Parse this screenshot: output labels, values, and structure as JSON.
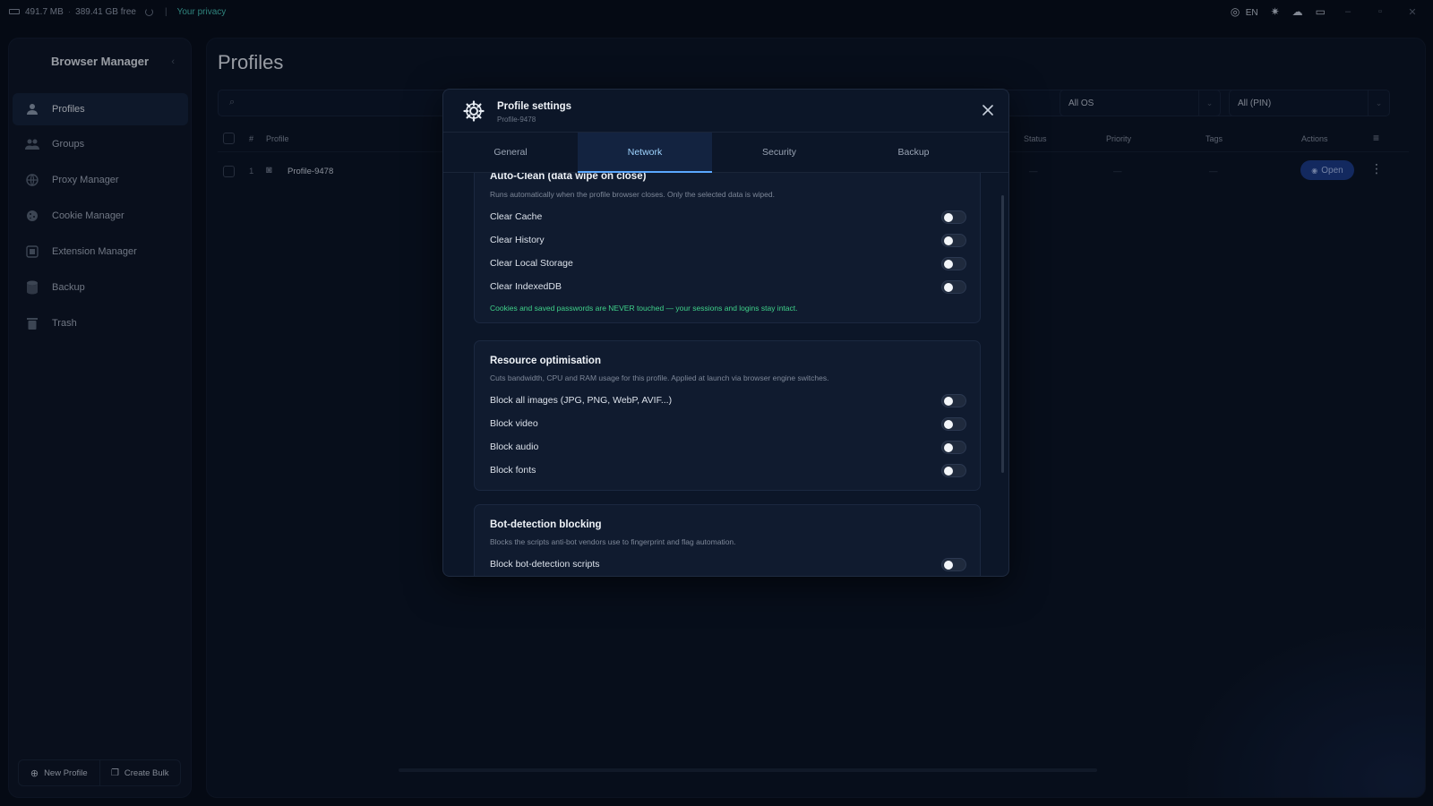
{
  "titlebar": {
    "memory": "491.7 MB",
    "disk": "389.41 GB free",
    "privacy_link": "Your privacy",
    "language": "EN"
  },
  "sidebar": {
    "title": "Browser Manager",
    "items": [
      {
        "label": "Profiles",
        "icon": "user-icon"
      },
      {
        "label": "Groups",
        "icon": "users-icon"
      },
      {
        "label": "Proxy Manager",
        "icon": "globe-icon"
      },
      {
        "label": "Cookie Manager",
        "icon": "cookie-icon"
      },
      {
        "label": "Extension Manager",
        "icon": "puzzle-icon"
      },
      {
        "label": "Backup",
        "icon": "database-icon"
      },
      {
        "label": "Trash",
        "icon": "trash-icon"
      }
    ],
    "new_profile": "New Profile",
    "create_bulk": "Create Bulk"
  },
  "main": {
    "title": "Profiles",
    "filters": {
      "os": "All OS",
      "pin": "All (PIN)"
    },
    "columns": {
      "num": "#",
      "profile": "Profile",
      "status": "Status",
      "priority": "Priority",
      "tags": "Tags",
      "actions": "Actions"
    },
    "rows": [
      {
        "num": "1",
        "name": "Profile-9478",
        "status": "—",
        "priority": "—",
        "tags": "—",
        "open_label": "Open"
      }
    ]
  },
  "modal": {
    "title": "Profile settings",
    "subtitle": "Profile-9478",
    "tabs": [
      "General",
      "Network",
      "Security",
      "Backup"
    ],
    "active_tab": "Network",
    "sections": {
      "autoclean": {
        "title": "Auto-Clean (data wipe on close)",
        "desc": "Runs automatically when the profile browser closes. Only the selected data is wiped.",
        "options": [
          "Clear Cache",
          "Clear History",
          "Clear Local Storage",
          "Clear IndexedDB"
        ],
        "note": "Cookies and saved passwords are NEVER touched — your sessions and logins stay intact."
      },
      "resource": {
        "title": "Resource optimisation",
        "desc": "Cuts bandwidth, CPU and RAM usage for this profile. Applied at launch via browser engine switches.",
        "options": [
          "Block all images (JPG, PNG, WebP, AVIF...)",
          "Block video",
          "Block audio",
          "Block fonts"
        ]
      },
      "bot": {
        "title": "Bot-detection blocking",
        "desc": "Blocks the scripts anti-bot vendors use to fingerprint and flag automation.",
        "options": [
          "Block bot-detection scripts"
        ]
      }
    }
  },
  "colors": {
    "accent": "#5aa8ff",
    "note_green": "#3fd28a",
    "open_button": "#1d3c8a",
    "privacy": "#47c6b8"
  }
}
